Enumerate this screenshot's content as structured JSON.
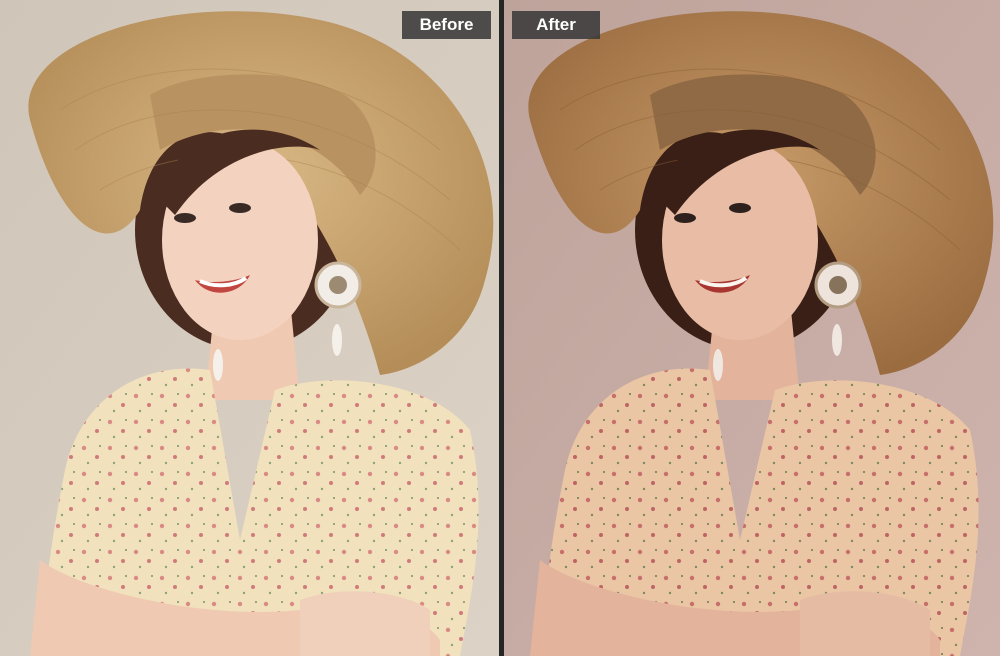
{
  "comparison": {
    "before_label": "Before",
    "after_label": "After"
  },
  "colors": {
    "label_bg": "#3a3a3a",
    "label_text": "#ffffff",
    "divider": "#262626",
    "before_backdrop": "#d6cbbf",
    "after_backdrop": "#c7ada7",
    "hat_before": "#c9a572",
    "hat_after": "#b88b5a",
    "dress_before": "#f0dfb8",
    "dress_after": "#e9c8a6"
  }
}
